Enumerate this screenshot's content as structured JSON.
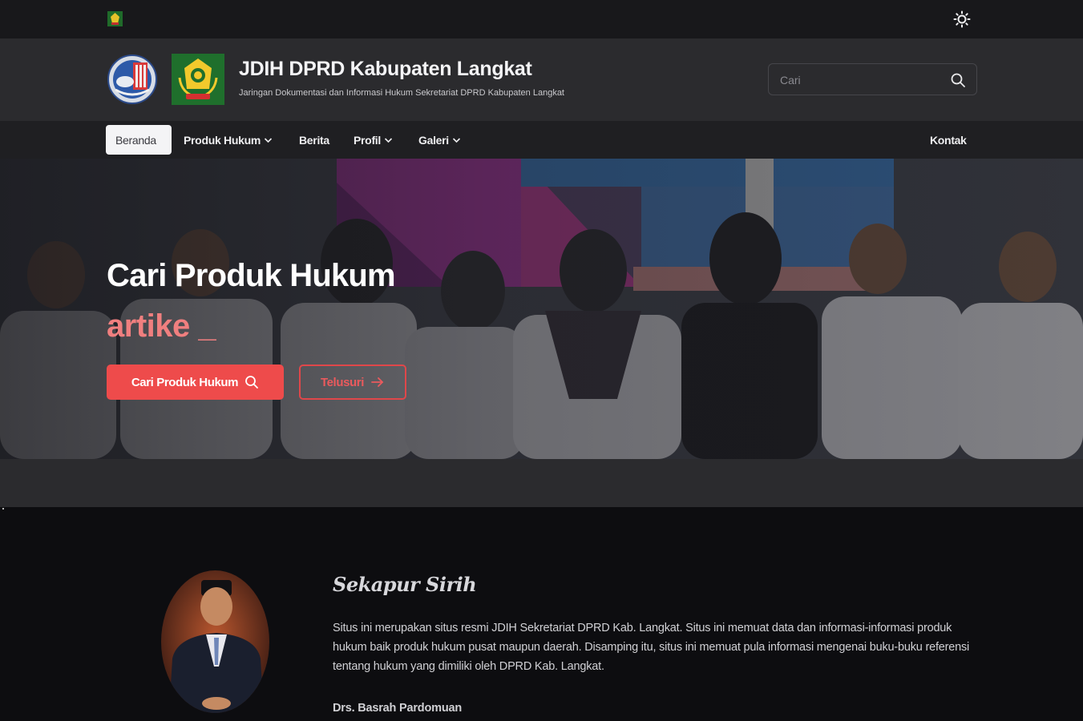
{
  "topbar": {
    "emblem_icon": "emblem-icon",
    "theme_toggle_icon": "sun-icon"
  },
  "header": {
    "title": "JDIH DPRD Kabupaten Langkat",
    "subtitle": "Jaringan Dokumentasi dan Informasi Hukum Sekretariat DPRD Kabupaten Langkat",
    "logos": [
      "dprd-logo",
      "kabupaten-langkat-logo"
    ],
    "search": {
      "placeholder": "Cari",
      "value": ""
    }
  },
  "nav": {
    "items": [
      {
        "label": "Beranda",
        "active": true,
        "dropdown": false
      },
      {
        "label": "Produk Hukum",
        "active": false,
        "dropdown": true
      },
      {
        "label": "Berita",
        "active": false,
        "dropdown": false
      },
      {
        "label": "Profil",
        "active": false,
        "dropdown": true
      },
      {
        "label": "Galeri",
        "active": false,
        "dropdown": true
      }
    ],
    "right_item": {
      "label": "Kontak"
    }
  },
  "hero": {
    "title": "Cari Produk Hukum",
    "typed_text": "artike _",
    "primary_button": "Cari Produk Hukum",
    "secondary_button": "Telusuri"
  },
  "sekapur_sirih": {
    "title": "Sekapur Sirih",
    "text": "Situs ini merupakan situs resmi JDIH Sekretariat DPRD Kab. Langkat. Situs ini memuat data dan informasi-informasi produk hukum baik produk hukum pusat maupun daerah. Disamping itu, situs ini memuat pula informasi mengenai buku-buku referensi tentang hukum yang dimiliki oleh DPRD Kab. Langkat.",
    "name": "Drs. Basrah Pardomuan"
  },
  "colors": {
    "accent": "#ee4b4b",
    "typed_text": "#f07f7f",
    "background": "#0d0d10",
    "header": "#2b2b2e"
  }
}
